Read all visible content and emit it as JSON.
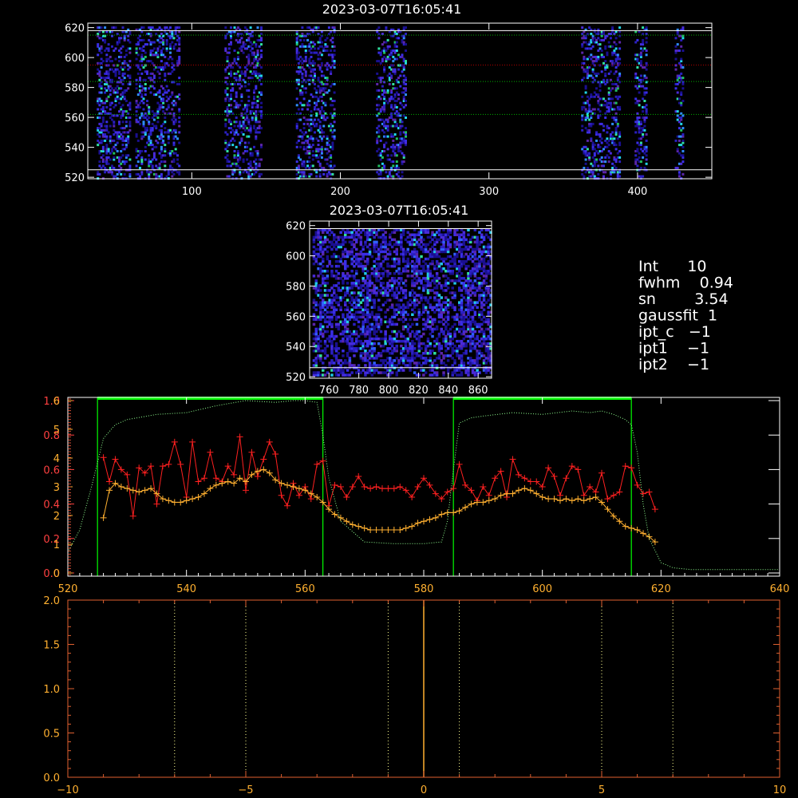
{
  "panels": {
    "top_image": {
      "title": "2023-03-07T16:05:41",
      "x_ticks": [
        "100",
        "200",
        "300",
        "400"
      ],
      "y_ticks": [
        "520",
        "540",
        "560",
        "580",
        "600",
        "620"
      ],
      "xlim": [
        30,
        450
      ],
      "ylim": [
        519,
        623
      ],
      "column_groups": [
        [
          36,
          58
        ],
        [
          62,
          92
        ],
        [
          122,
          146
        ],
        [
          170,
          196
        ],
        [
          224,
          244
        ],
        [
          362,
          388
        ],
        [
          398,
          406
        ],
        [
          425,
          430
        ]
      ],
      "white_lines_y": [
        525,
        618
      ],
      "dotted_lines": [
        {
          "y": 615,
          "color": "#00b000"
        },
        {
          "y": 595,
          "color": "#b00000"
        },
        {
          "y": 584,
          "color": "#00b000"
        },
        {
          "y": 562,
          "color": "#00b000"
        }
      ]
    },
    "mid_image": {
      "title": "2023-03-07T16:05:41",
      "x_ticks": [
        "760",
        "780",
        "800",
        "820",
        "840",
        "860"
      ],
      "y_ticks": [
        "520",
        "540",
        "560",
        "580",
        "600",
        "620"
      ],
      "xlim": [
        747,
        869
      ],
      "ylim": [
        519,
        623
      ]
    },
    "info": {
      "lines": [
        "Int      10",
        "fwhm    0.94",
        "sn        3.54",
        "gaussfit  1",
        "ipt_c   −1",
        "ipt1    −1",
        "ipt2    −1"
      ]
    }
  },
  "chart_data": [
    {
      "type": "image",
      "title": "2023-03-07T16:05:41",
      "xlim": [
        30,
        450
      ],
      "ylim": [
        519,
        623
      ],
      "x_ticks": [
        100,
        200,
        300,
        400
      ],
      "y_ticks": [
        520,
        540,
        560,
        580,
        600,
        620
      ]
    },
    {
      "type": "image",
      "title": "2023-03-07T16:05:41",
      "xlim": [
        747,
        869
      ],
      "ylim": [
        519,
        623
      ],
      "x_ticks": [
        760,
        780,
        800,
        820,
        840,
        860
      ],
      "y_ticks": [
        520,
        540,
        560,
        580,
        600,
        620
      ]
    },
    {
      "type": "line",
      "xlim": [
        520,
        640
      ],
      "ylim": [
        0,
        1
      ],
      "x_ticks": [
        "520",
        "540",
        "560",
        "580",
        "600",
        "620",
        "640"
      ],
      "left_axis_ticks_red": [
        "0.0",
        "0.2",
        "0.4",
        "0.6",
        "0.8",
        "1.0"
      ],
      "left_axis_ticks_orange": [
        "0",
        "1",
        "2",
        "3",
        "4",
        "5",
        "6"
      ],
      "bands": [
        [
          525,
          563
        ],
        [
          585,
          615
        ]
      ],
      "series": [
        {
          "color": "#ff2020",
          "x": [
            526,
            527,
            528,
            529,
            530,
            531,
            532,
            533,
            534,
            535,
            536,
            537,
            538,
            539,
            540,
            541,
            542,
            543,
            544,
            545,
            546,
            547,
            548,
            549,
            550,
            551,
            552,
            553,
            554,
            555,
            556,
            557,
            558,
            559,
            560,
            561,
            562,
            563,
            564,
            565,
            566,
            567,
            568,
            569,
            570,
            571,
            572,
            573,
            574,
            575,
            576,
            577,
            578,
            579,
            580,
            581,
            582,
            583,
            584,
            585,
            586,
            587,
            588,
            589,
            590,
            591,
            592,
            593,
            594,
            595,
            596,
            597,
            598,
            599,
            600,
            601,
            602,
            603,
            604,
            605,
            606,
            607,
            608,
            609,
            610,
            611,
            612,
            613,
            614,
            615,
            616,
            617,
            618,
            619
          ],
          "y": [
            0.67,
            0.53,
            0.66,
            0.6,
            0.57,
            0.33,
            0.61,
            0.58,
            0.62,
            0.4,
            0.62,
            0.63,
            0.76,
            0.63,
            0.44,
            0.76,
            0.53,
            0.55,
            0.7,
            0.55,
            0.53,
            0.62,
            0.57,
            0.79,
            0.48,
            0.7,
            0.56,
            0.66,
            0.76,
            0.69,
            0.45,
            0.39,
            0.52,
            0.45,
            0.5,
            0.43,
            0.63,
            0.65,
            0.39,
            0.51,
            0.5,
            0.44,
            0.5,
            0.56,
            0.5,
            0.49,
            0.5,
            0.49,
            0.49,
            0.49,
            0.5,
            0.48,
            0.44,
            0.5,
            0.55,
            0.51,
            0.46,
            0.43,
            0.47,
            0.49,
            0.63,
            0.51,
            0.48,
            0.42,
            0.5,
            0.45,
            0.55,
            0.59,
            0.44,
            0.66,
            0.57,
            0.55,
            0.53,
            0.53,
            0.5,
            0.61,
            0.56,
            0.45,
            0.55,
            0.62,
            0.6,
            0.45,
            0.5,
            0.47,
            0.58,
            0.43,
            0.45,
            0.47,
            0.62,
            0.61,
            0.51,
            0.46,
            0.47,
            0.37
          ]
        },
        {
          "color": "#ffb030",
          "x": [
            526,
            527,
            528,
            529,
            530,
            531,
            532,
            533,
            534,
            535,
            536,
            537,
            538,
            539,
            540,
            541,
            542,
            543,
            544,
            545,
            546,
            547,
            548,
            549,
            550,
            551,
            552,
            553,
            554,
            555,
            556,
            557,
            558,
            559,
            560,
            561,
            562,
            563,
            564,
            565,
            566,
            567,
            568,
            569,
            570,
            571,
            572,
            573,
            574,
            575,
            576,
            577,
            578,
            579,
            580,
            581,
            582,
            583,
            584,
            585,
            586,
            587,
            588,
            589,
            590,
            591,
            592,
            593,
            594,
            595,
            596,
            597,
            598,
            599,
            600,
            601,
            602,
            603,
            604,
            605,
            606,
            607,
            608,
            609,
            610,
            611,
            612,
            613,
            614,
            615,
            616,
            617,
            618,
            619
          ],
          "y": [
            0.32,
            0.48,
            0.52,
            0.5,
            0.49,
            0.48,
            0.47,
            0.48,
            0.49,
            0.46,
            0.43,
            0.42,
            0.41,
            0.41,
            0.42,
            0.43,
            0.44,
            0.46,
            0.49,
            0.51,
            0.52,
            0.53,
            0.52,
            0.55,
            0.53,
            0.57,
            0.59,
            0.6,
            0.58,
            0.54,
            0.52,
            0.51,
            0.5,
            0.49,
            0.48,
            0.46,
            0.44,
            0.41,
            0.37,
            0.34,
            0.32,
            0.3,
            0.28,
            0.27,
            0.26,
            0.25,
            0.25,
            0.25,
            0.25,
            0.25,
            0.25,
            0.26,
            0.27,
            0.29,
            0.3,
            0.31,
            0.32,
            0.34,
            0.35,
            0.35,
            0.36,
            0.38,
            0.4,
            0.41,
            0.41,
            0.42,
            0.43,
            0.45,
            0.46,
            0.46,
            0.48,
            0.49,
            0.48,
            0.46,
            0.44,
            0.43,
            0.43,
            0.42,
            0.43,
            0.42,
            0.43,
            0.42,
            0.43,
            0.44,
            0.41,
            0.37,
            0.33,
            0.3,
            0.27,
            0.26,
            0.25,
            0.23,
            0.21,
            0.18
          ]
        },
        {
          "color": "#90ff90",
          "style": "dotted",
          "x": [
            520,
            522,
            524,
            526,
            528,
            530,
            535,
            540,
            545,
            550,
            555,
            558,
            560,
            562,
            563,
            564,
            566,
            570,
            575,
            580,
            583,
            584,
            585,
            586,
            588,
            590,
            595,
            600,
            605,
            608,
            610,
            612,
            614,
            615,
            616,
            617,
            618,
            620,
            622,
            625,
            630,
            640
          ],
          "y": [
            0.12,
            0.25,
            0.5,
            0.78,
            0.86,
            0.89,
            0.92,
            0.93,
            0.97,
            1.0,
            0.99,
            1.0,
            1.0,
            0.99,
            0.8,
            0.55,
            0.3,
            0.18,
            0.17,
            0.17,
            0.18,
            0.3,
            0.6,
            0.87,
            0.9,
            0.91,
            0.93,
            0.92,
            0.94,
            0.93,
            0.94,
            0.92,
            0.89,
            0.86,
            0.7,
            0.4,
            0.2,
            0.06,
            0.03,
            0.02,
            0.02,
            0.02
          ]
        }
      ]
    },
    {
      "type": "line",
      "xlim": [
        -10,
        10
      ],
      "ylim": [
        0,
        2
      ],
      "x_ticks": [
        "−10",
        "−5",
        "0",
        "5",
        "10"
      ],
      "y_ticks": [
        "0.0",
        "0.5",
        "1.0",
        "1.5",
        "2.0"
      ],
      "vlines_dotted": [
        -7,
        -5,
        -1,
        1,
        5,
        7
      ],
      "vline_solid": 0
    }
  ]
}
